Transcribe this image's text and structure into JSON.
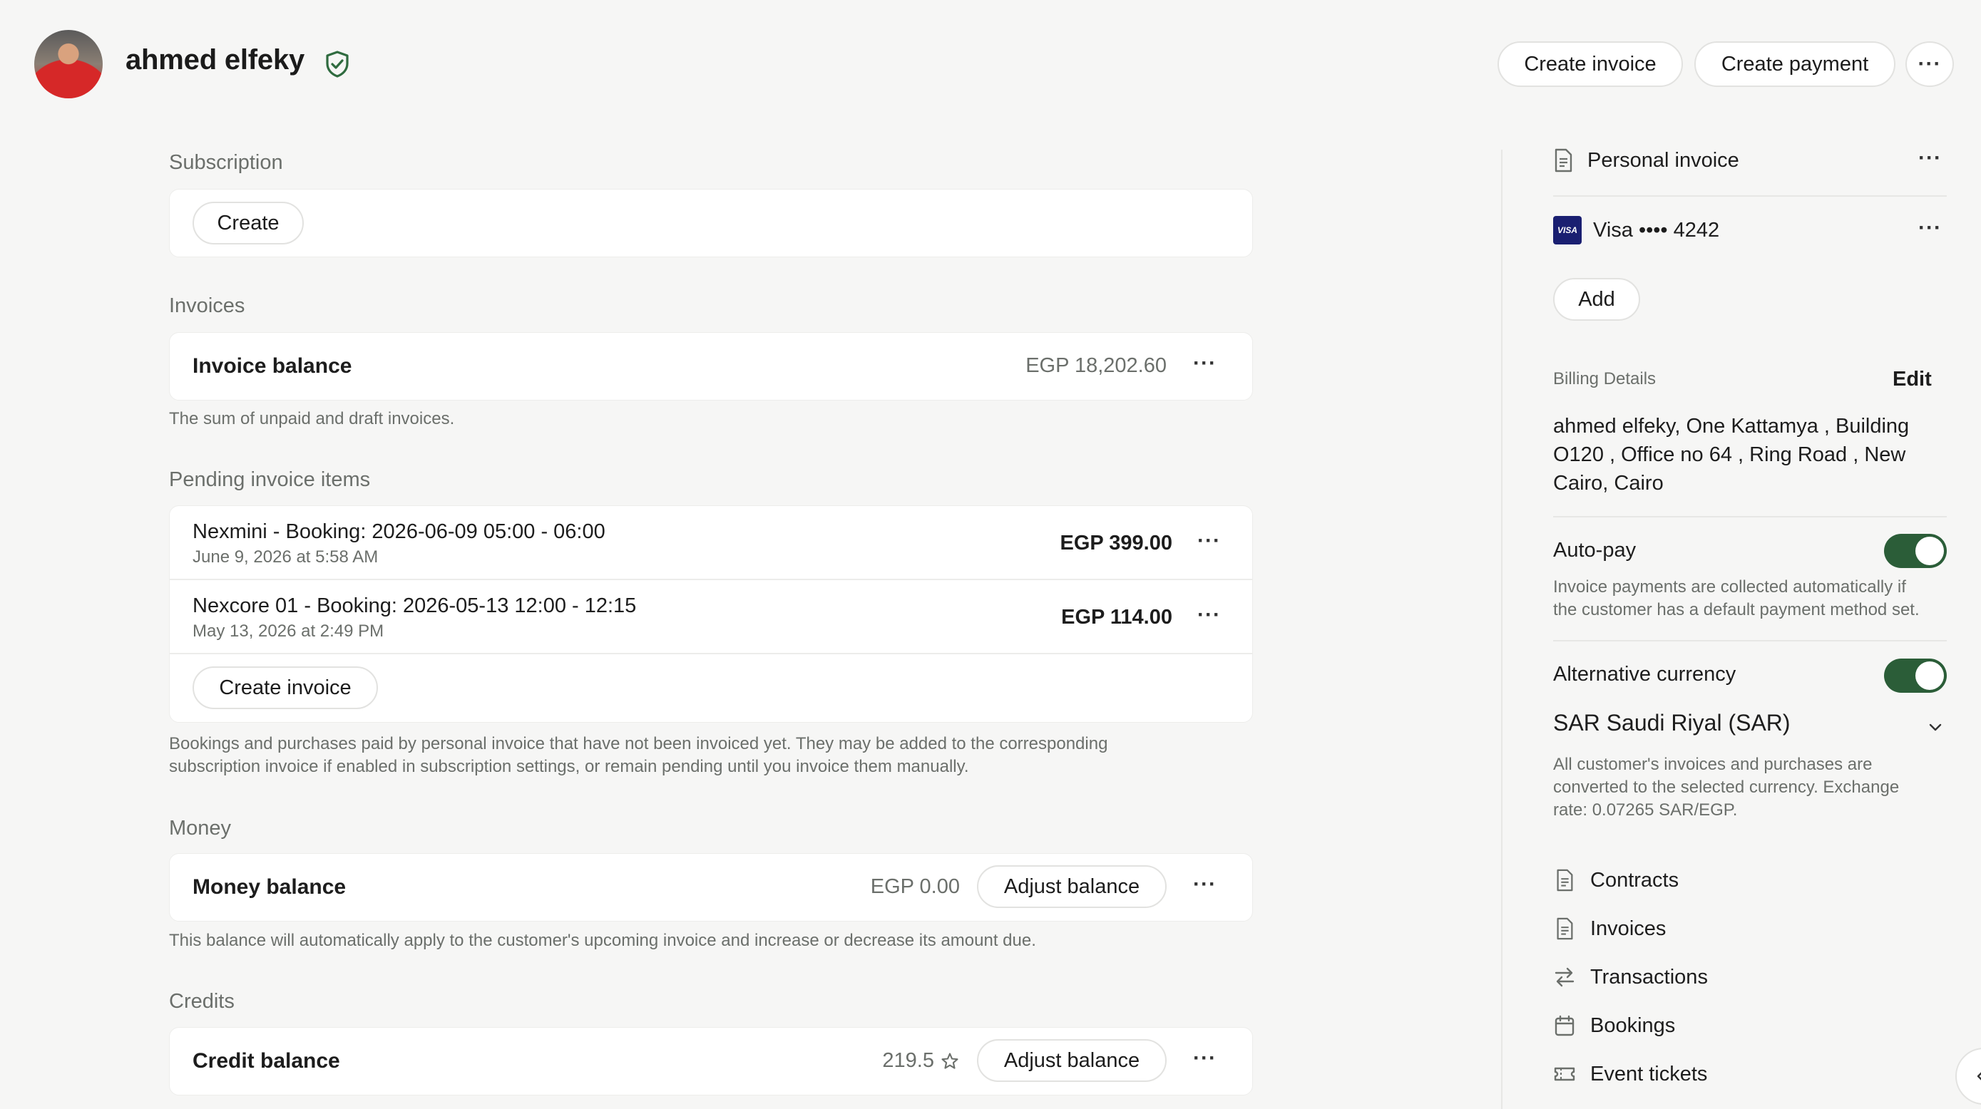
{
  "header": {
    "customer_name": "ahmed elfeky",
    "create_invoice_label": "Create invoice",
    "create_payment_label": "Create payment",
    "more_label": "···"
  },
  "subscription": {
    "title": "Subscription",
    "create_label": "Create"
  },
  "invoices": {
    "title": "Invoices",
    "balance_label": "Invoice balance",
    "balance_value": "EGP 18,202.60",
    "more_label": "···",
    "hint": "The sum of unpaid and draft invoices."
  },
  "pending": {
    "title": "Pending invoice items",
    "items": [
      {
        "name": "Nexmini - Booking: 2026-06-09 05:00 - 06:00",
        "date": "June 9, 2026 at 5:58 AM",
        "amount": "EGP 399.00",
        "more": "···"
      },
      {
        "name": "Nexcore 01 - Booking: 2026-05-13 12:00 - 12:15",
        "date": "May 13, 2026 at 2:49 PM",
        "amount": "EGP 114.00",
        "more": "···"
      }
    ],
    "create_invoice_label": "Create invoice",
    "hint_line1": "Bookings and purchases paid by personal invoice that have not been invoiced yet. They may be added to the corresponding",
    "hint_line2": "subscription invoice if enabled in subscription settings, or remain pending until you invoice them manually."
  },
  "money": {
    "title": "Money",
    "balance_label": "Money balance",
    "balance_value": "EGP 0.00",
    "adjust_label": "Adjust balance",
    "more_label": "···",
    "hint": "This balance will automatically apply to the customer's upcoming invoice and increase or decrease its amount due."
  },
  "credits": {
    "title": "Credits",
    "balance_label": "Credit balance",
    "balance_value": "219.5",
    "adjust_label": "Adjust balance",
    "more_label": "···"
  },
  "sidebar": {
    "payment_method_label": "Personal invoice",
    "card_brand": "VISA",
    "card_label": "Visa •••• 4242",
    "more_label": "···",
    "add_label": "Add",
    "billing_title": "Billing Details",
    "billing_edit_label": "Edit",
    "billing_line1": "ahmed elfeky, One Kattamya , Building",
    "billing_line2": "O120 , Office no 64 , Ring Road , New",
    "billing_line3": "Cairo, Cairo",
    "autopay_label": "Auto-pay",
    "autopay_enabled": true,
    "autopay_hint_line1": "Invoice payments are collected automatically if",
    "autopay_hint_line2": "the customer has a default payment method set.",
    "alt_currency_label": "Alternative currency",
    "alt_currency_enabled": true,
    "currency_selected": "SAR Saudi Riyal (SAR)",
    "currency_hint_line1": "All customer's invoices and purchases are",
    "currency_hint_line2": "converted to the selected currency. Exchange",
    "currency_hint_line3": "rate: 0.07265 SAR/EGP.",
    "nav": [
      {
        "label": "Contracts",
        "icon": "document-icon"
      },
      {
        "label": "Invoices",
        "icon": "document-icon"
      },
      {
        "label": "Transactions",
        "icon": "swap-arrows-icon"
      },
      {
        "label": "Bookings",
        "icon": "calendar-icon"
      },
      {
        "label": "Event tickets",
        "icon": "ticket-icon"
      }
    ]
  },
  "colors": {
    "accent_green": "#2b5d38",
    "background": "#f6f6f5",
    "visa_blue": "#1a1f71"
  }
}
